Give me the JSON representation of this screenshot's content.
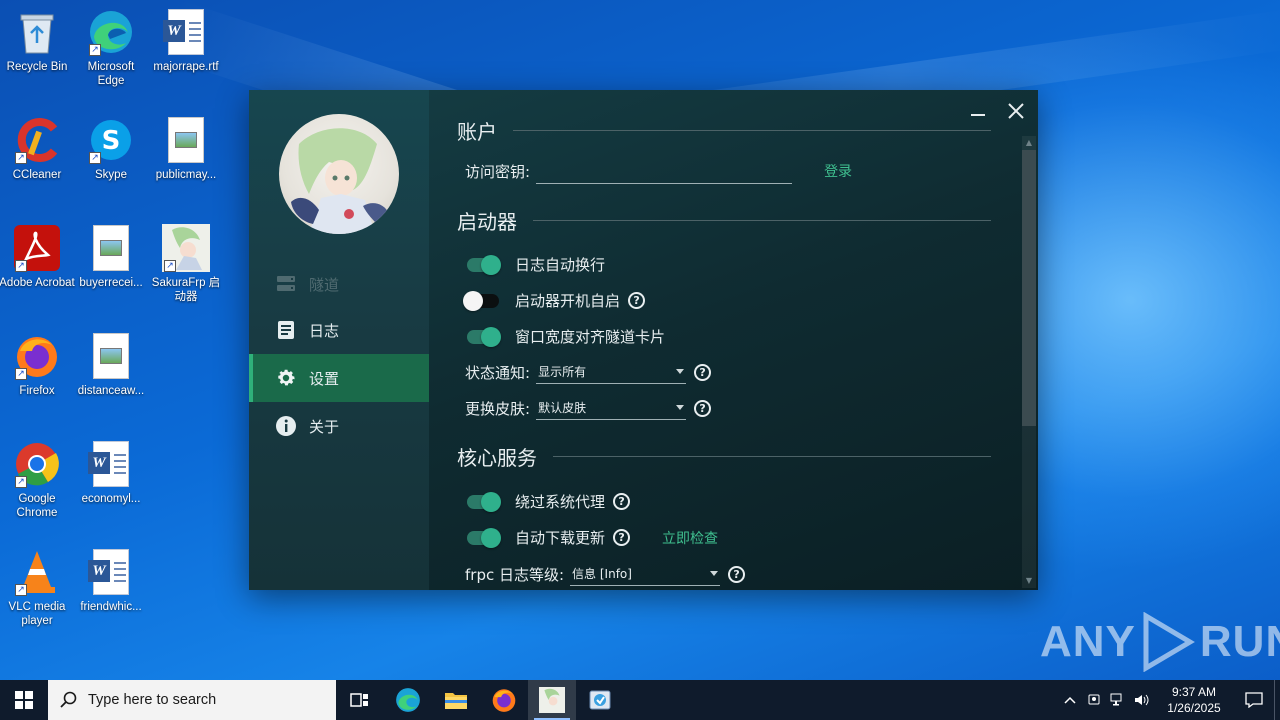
{
  "desktop": {
    "icons": [
      {
        "label": "Recycle Bin"
      },
      {
        "label": "Microsoft Edge"
      },
      {
        "label": "majorrape.rtf"
      },
      {
        "label": "CCleaner"
      },
      {
        "label": "Skype"
      },
      {
        "label": "publicmay..."
      },
      {
        "label": "Adobe Acrobat"
      },
      {
        "label": "buyerrecei..."
      },
      {
        "label": "SakuraFrp 启动器"
      },
      {
        "label": "Firefox"
      },
      {
        "label": "distanceaw..."
      },
      {
        "label": "Google Chrome"
      },
      {
        "label": "economyl..."
      },
      {
        "label": "VLC media player"
      },
      {
        "label": "friendwhic..."
      }
    ],
    "watermark": {
      "left": "ANY",
      "right": "RUN"
    }
  },
  "app": {
    "nav": [
      {
        "label": "隧道",
        "icon": "server-icon",
        "state": "disabled"
      },
      {
        "label": "日志",
        "icon": "document-list-icon",
        "state": "normal"
      },
      {
        "label": "设置",
        "icon": "gear-icon",
        "state": "active"
      },
      {
        "label": "关于",
        "icon": "info-icon",
        "state": "normal"
      }
    ],
    "sections": {
      "account": {
        "title": "账户",
        "access_key_label": "访问密钥:",
        "access_key_value": "",
        "login_link": "登录"
      },
      "launcher": {
        "title": "启动器",
        "log_wrap": {
          "label": "日志自动换行",
          "on": true
        },
        "autostart": {
          "label": "启动器开机自启",
          "on": false
        },
        "align_width": {
          "label": "窗口宽度对齐隧道卡片",
          "on": true
        },
        "notify": {
          "label": "状态通知:",
          "value": "显示所有"
        },
        "skin": {
          "label": "更换皮肤:",
          "value": "默认皮肤"
        }
      },
      "core": {
        "title": "核心服务",
        "bypass_proxy": {
          "label": "绕过系统代理",
          "on": true
        },
        "auto_update": {
          "label": "自动下载更新",
          "on": true,
          "check_link": "立即检查"
        },
        "log_level": {
          "label": "frpc 日志等级:",
          "value": "信息 [Info]"
        }
      }
    }
  },
  "taskbar": {
    "search_placeholder": "Type here to search",
    "time": "9:37 AM",
    "date": "1/26/2025"
  },
  "colors": {
    "accent": "#2fb08c",
    "link": "#3fbf8f",
    "nav_active": "#1a6a4a",
    "taskbar": "#0f1b2c"
  }
}
